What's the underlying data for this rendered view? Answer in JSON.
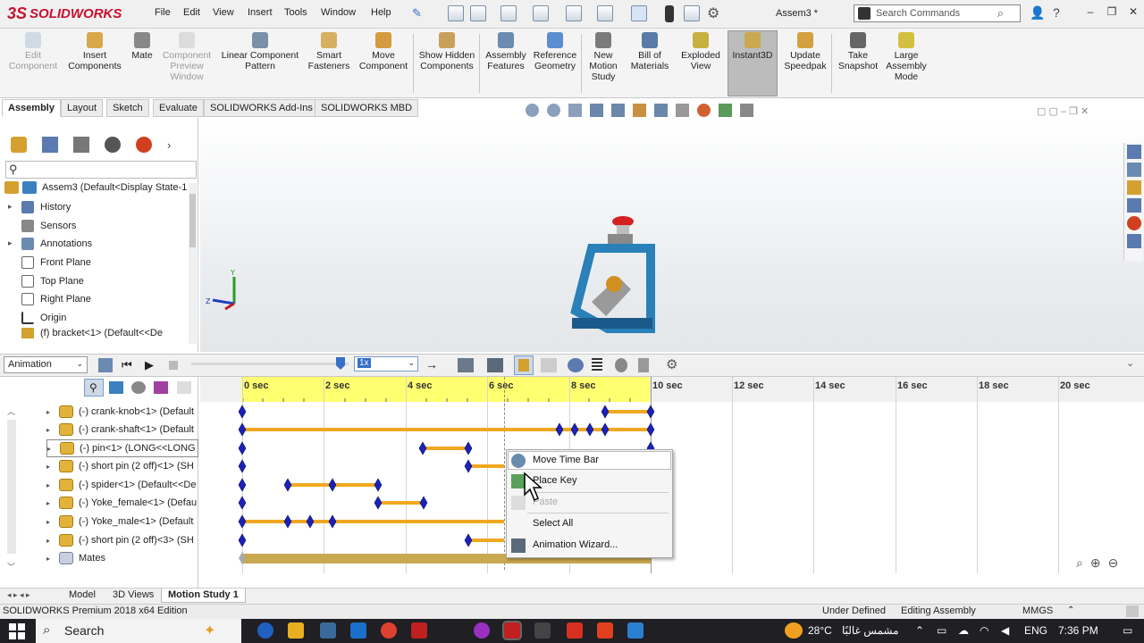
{
  "app": {
    "brand": "SOLIDWORKS",
    "doc_title": "Assem3 *",
    "menus": [
      "File",
      "Edit",
      "View",
      "Insert",
      "Tools",
      "Window",
      "Help"
    ],
    "search": {
      "placeholder": "Search Commands"
    }
  },
  "command_manager": {
    "commands": [
      {
        "label": "Edit Component",
        "disabled": true
      },
      {
        "label": "Insert Components",
        "disabled": false
      },
      {
        "label": "Mate",
        "disabled": false
      },
      {
        "label": "Component Preview Window",
        "disabled": true
      },
      {
        "label": "Linear Component Pattern",
        "disabled": false
      },
      {
        "label": "Smart Fasteners",
        "disabled": false
      },
      {
        "label": "Move Component",
        "disabled": false
      },
      {
        "label": "Show Hidden Components",
        "disabled": false
      },
      {
        "label": "Assembly Features",
        "disabled": false
      },
      {
        "label": "Reference Geometry",
        "disabled": false
      },
      {
        "label": "New Motion Study",
        "disabled": false
      },
      {
        "label": "Bill of Materials",
        "disabled": false
      },
      {
        "label": "Exploded View",
        "disabled": false
      },
      {
        "label": "Instant3D",
        "disabled": false
      },
      {
        "label": "Update Speedpak",
        "disabled": false
      },
      {
        "label": "Take Snapshot",
        "disabled": false
      },
      {
        "label": "Large Assembly Mode",
        "disabled": false
      }
    ],
    "tabs": [
      "Assembly",
      "Layout",
      "Sketch",
      "Evaluate",
      "SOLIDWORKS Add-Ins",
      "SOLIDWORKS MBD"
    ],
    "active_tab": "Assembly"
  },
  "feature_tree": {
    "root": "Assem3  (Default<Display State-1",
    "items": [
      "History",
      "Sensors",
      "Annotations",
      "Front Plane",
      "Top Plane",
      "Right Plane",
      "Origin",
      "(f) bracket<1> (Default<<De"
    ]
  },
  "animation": {
    "study_type": "Animation",
    "playback_speed": "1x"
  },
  "motion_study": {
    "components": [
      "(-) crank-knob<1> (Default",
      "(-) crank-shaft<1> (Default",
      "(-) pin<1> (LONG<<LONG",
      "(-) short pin (2 off)<1> (SH",
      "(-) spider<1> (Default<<De",
      "(-) Yoke_female<1> (Defau",
      "(-) Yoke_male<1> (Default",
      "(-) short pin (2 off)<3> (SH",
      "Mates"
    ],
    "time_labels": [
      "0 sec",
      "2 sec",
      "4 sec",
      "6 sec",
      "8 sec",
      "10 sec",
      "12 sec",
      "14 sec",
      "16 sec",
      "18 sec",
      "20 sec"
    ]
  },
  "context_menu": {
    "items": [
      {
        "label": "Move Time Bar",
        "disabled": false
      },
      {
        "label": "Place Key",
        "disabled": false
      },
      {
        "label": "Paste",
        "disabled": true
      },
      {
        "label": "Select All",
        "disabled": false
      },
      {
        "label": "Animation Wizard...",
        "disabled": false
      }
    ]
  },
  "bottom_tabs": [
    "Model",
    "3D Views",
    "Motion Study 1"
  ],
  "status": {
    "edition": "SOLIDWORKS Premium 2018 x64 Edition",
    "definition": "Under Defined",
    "mode": "Editing Assembly",
    "units": "MMGS"
  },
  "taskbar": {
    "search": "Search",
    "weather": "28°C",
    "weather_text": "مشمس غالبًا",
    "language": "ENG",
    "time": "7:36 PM"
  },
  "colors": {
    "accent": "#c8102e",
    "bar": "#f0a820",
    "key": "#1a22b8",
    "ruler_active": "#ffff70"
  }
}
